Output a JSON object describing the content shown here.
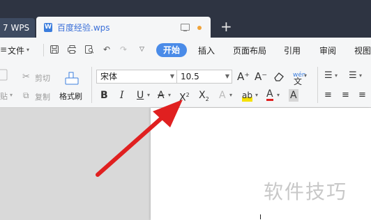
{
  "tabs": {
    "inactive_label": "7 WPS",
    "active_label": "百度经验.wps",
    "new_tab_symbol": "+",
    "doc_icon_letter": "W",
    "unsaved_dot_color": "#f0a33a"
  },
  "menu": {
    "file_label": "文件",
    "start_label": "开始",
    "insert_label": "插入",
    "layout_label": "页面布局",
    "references_label": "引用",
    "review_label": "审阅",
    "view_label": "视图"
  },
  "ribbon": {
    "cut_label": "剪切",
    "copy_label": "复制",
    "paste_label": "贴",
    "format_painter_label": "格式刷",
    "font_name": "宋体",
    "font_size": "10.5",
    "bold": "B",
    "italic": "I",
    "underline": "U",
    "grow_font": "A⁺",
    "shrink_font": "A⁻",
    "pinyin": "wén"
  },
  "watermark_text": "软件技巧",
  "colors": {
    "accent": "#4a8be8",
    "arrow": "#e02020",
    "titlebar": "#2e3442"
  }
}
